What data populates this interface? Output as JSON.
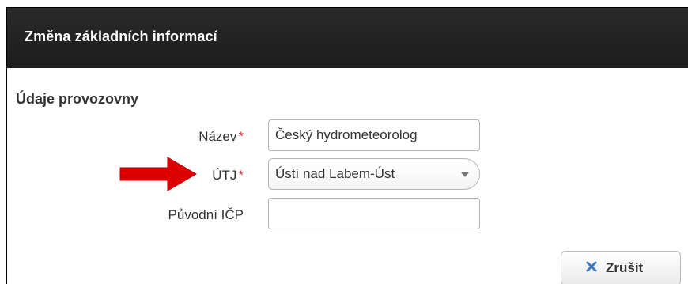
{
  "dialog": {
    "title": "Změna základních informací",
    "section_title": "Údaje provozovny",
    "fields": [
      {
        "label": "Název",
        "required_mark": "*",
        "value": "Český hydrometeorolog"
      },
      {
        "label": "ÚTJ",
        "required_mark": "*",
        "selected_value": "Ústí nad Labem-Úst"
      },
      {
        "label": "Původní IČP",
        "value": "",
        "placeholder": ""
      }
    ],
    "cancel_button_label": "Zrušit"
  },
  "colors": {
    "titlebar_bg": "#1f1f1f",
    "required": "#d32f2f",
    "arrow": "#dd0000",
    "cancel_icon": "#3a78c4"
  },
  "icons": {
    "pointer_arrow": "red-arrow-icon",
    "cancel": "close-icon",
    "select": "chevron-down-icon"
  }
}
